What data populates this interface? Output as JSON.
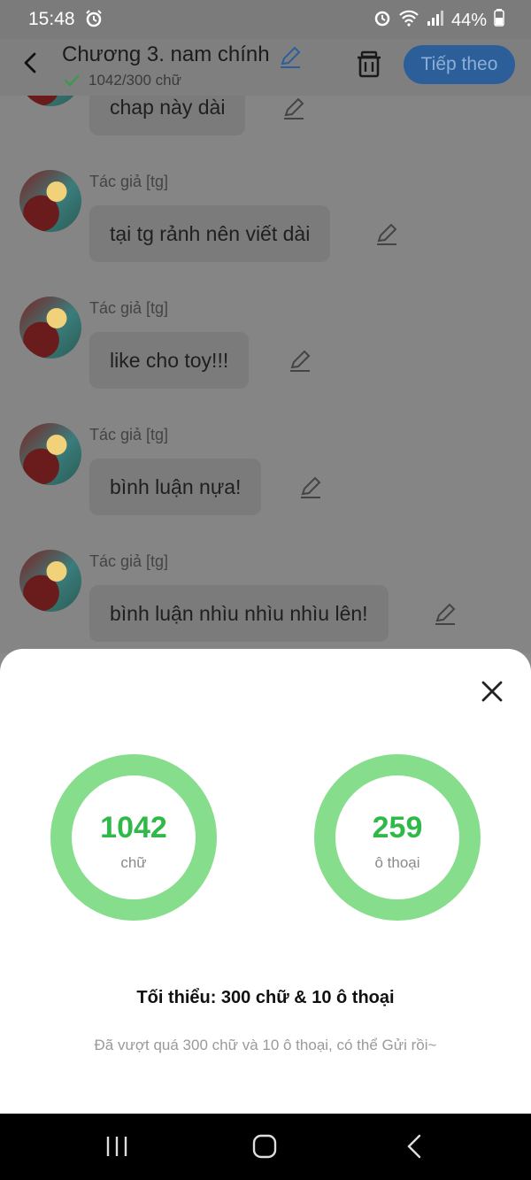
{
  "status_bar": {
    "time": "15:48",
    "battery": "44%"
  },
  "header": {
    "title": "Chương 3. nam chính",
    "word_count": "1042/300 chữ",
    "next_label": "Tiếp theo"
  },
  "messages": [
    {
      "author": "",
      "text": "chap này dài"
    },
    {
      "author": "Tác giả [tg]",
      "text": "tại tg rảnh nên viết dài"
    },
    {
      "author": "Tác giả [tg]",
      "text": "like cho toy!!!"
    },
    {
      "author": "Tác giả [tg]",
      "text": "bình luận nựa!"
    },
    {
      "author": "Tác giả [tg]",
      "text": "bình luận nhìu nhìu nhìu lên!"
    }
  ],
  "stats": {
    "words": {
      "value": "1042",
      "unit": "chữ"
    },
    "dialogs": {
      "value": "259",
      "unit": "ô thoại"
    },
    "minimum": "Tối thiểu: 300 chữ & 10 ô thoại",
    "note": "Đã vượt quá 300 chữ và 10 ô thoại, có thể Gửi rồi~"
  },
  "colors": {
    "ring": "#86dd8c",
    "number": "#2fb948",
    "accent": "#2c5f99"
  }
}
